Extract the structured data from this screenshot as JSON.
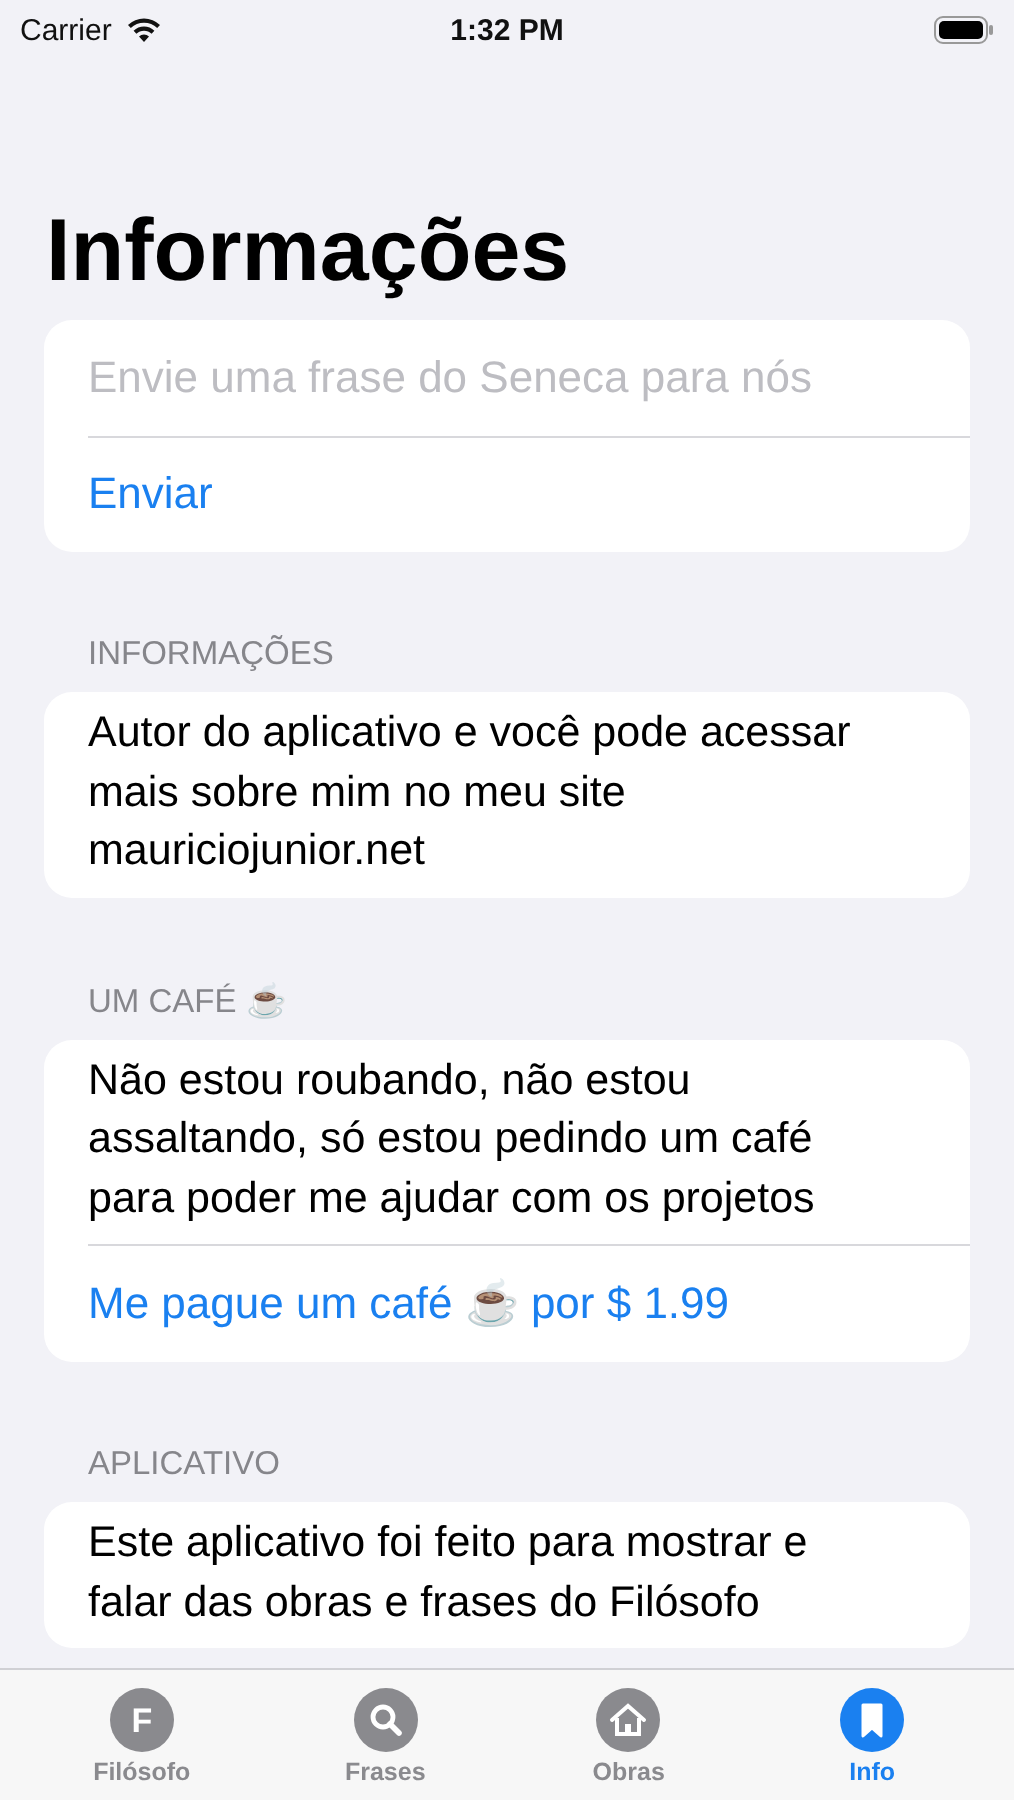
{
  "status_bar": {
    "carrier": "Carrier",
    "time": "1:32 PM"
  },
  "title": "Informações",
  "send_form": {
    "placeholder": "Envie uma frase do Seneca para nós",
    "button": "Enviar"
  },
  "sections": [
    {
      "header": "INFORMAÇÕES",
      "text": "Autor do aplicativo e você pode acessar mais sobre mim no meu site mauriciojunior.net"
    },
    {
      "header": "UM CAFÉ ☕",
      "text": "Não estou roubando, não estou assaltando, só estou pedindo um café para poder me ajudar com os projetos",
      "link": "Me pague um café ☕ por $ 1.99"
    },
    {
      "header": "APLICATIVO",
      "text": "Este aplicativo foi feito para mostrar e falar das obras e frases do Filósofo"
    }
  ],
  "tabs": [
    {
      "label": "Filósofo",
      "kind": "letter",
      "glyph": "F",
      "selected": false
    },
    {
      "label": "Frases",
      "kind": "search",
      "selected": false
    },
    {
      "label": "Obras",
      "kind": "house",
      "selected": false
    },
    {
      "label": "Info",
      "kind": "bookmark",
      "selected": true
    }
  ]
}
